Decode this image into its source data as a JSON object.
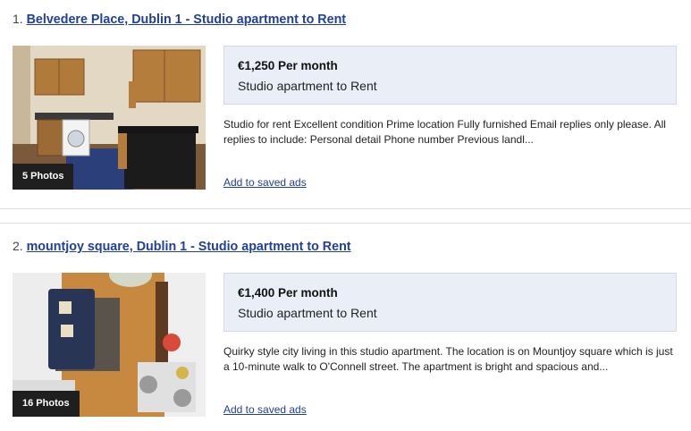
{
  "listings": [
    {
      "index": "1.",
      "title": "Belvedere Place, Dublin 1 - Studio apartment to Rent",
      "photo_count": "5 Photos",
      "price": "€1,250 Per month",
      "property_type": "Studio apartment to Rent",
      "description": "Studio for rent Excellent condition Prime location Fully furnished Email replies only please. All replies to include: Personal detail Phone number Previous landl...",
      "save_label": "Add to saved ads"
    },
    {
      "index": "2.",
      "title": "mountjoy square, Dublin 1 - Studio apartment to Rent",
      "photo_count": "16 Photos",
      "price": "€1,400 Per month",
      "property_type": "Studio apartment to Rent",
      "description": "Quirky style city living in this studio apartment. The location is on Mountjoy square which is just a 10-minute walk to O'Connell street. The apartment is bright and spacious and...",
      "save_label": "Add to saved ads"
    }
  ]
}
